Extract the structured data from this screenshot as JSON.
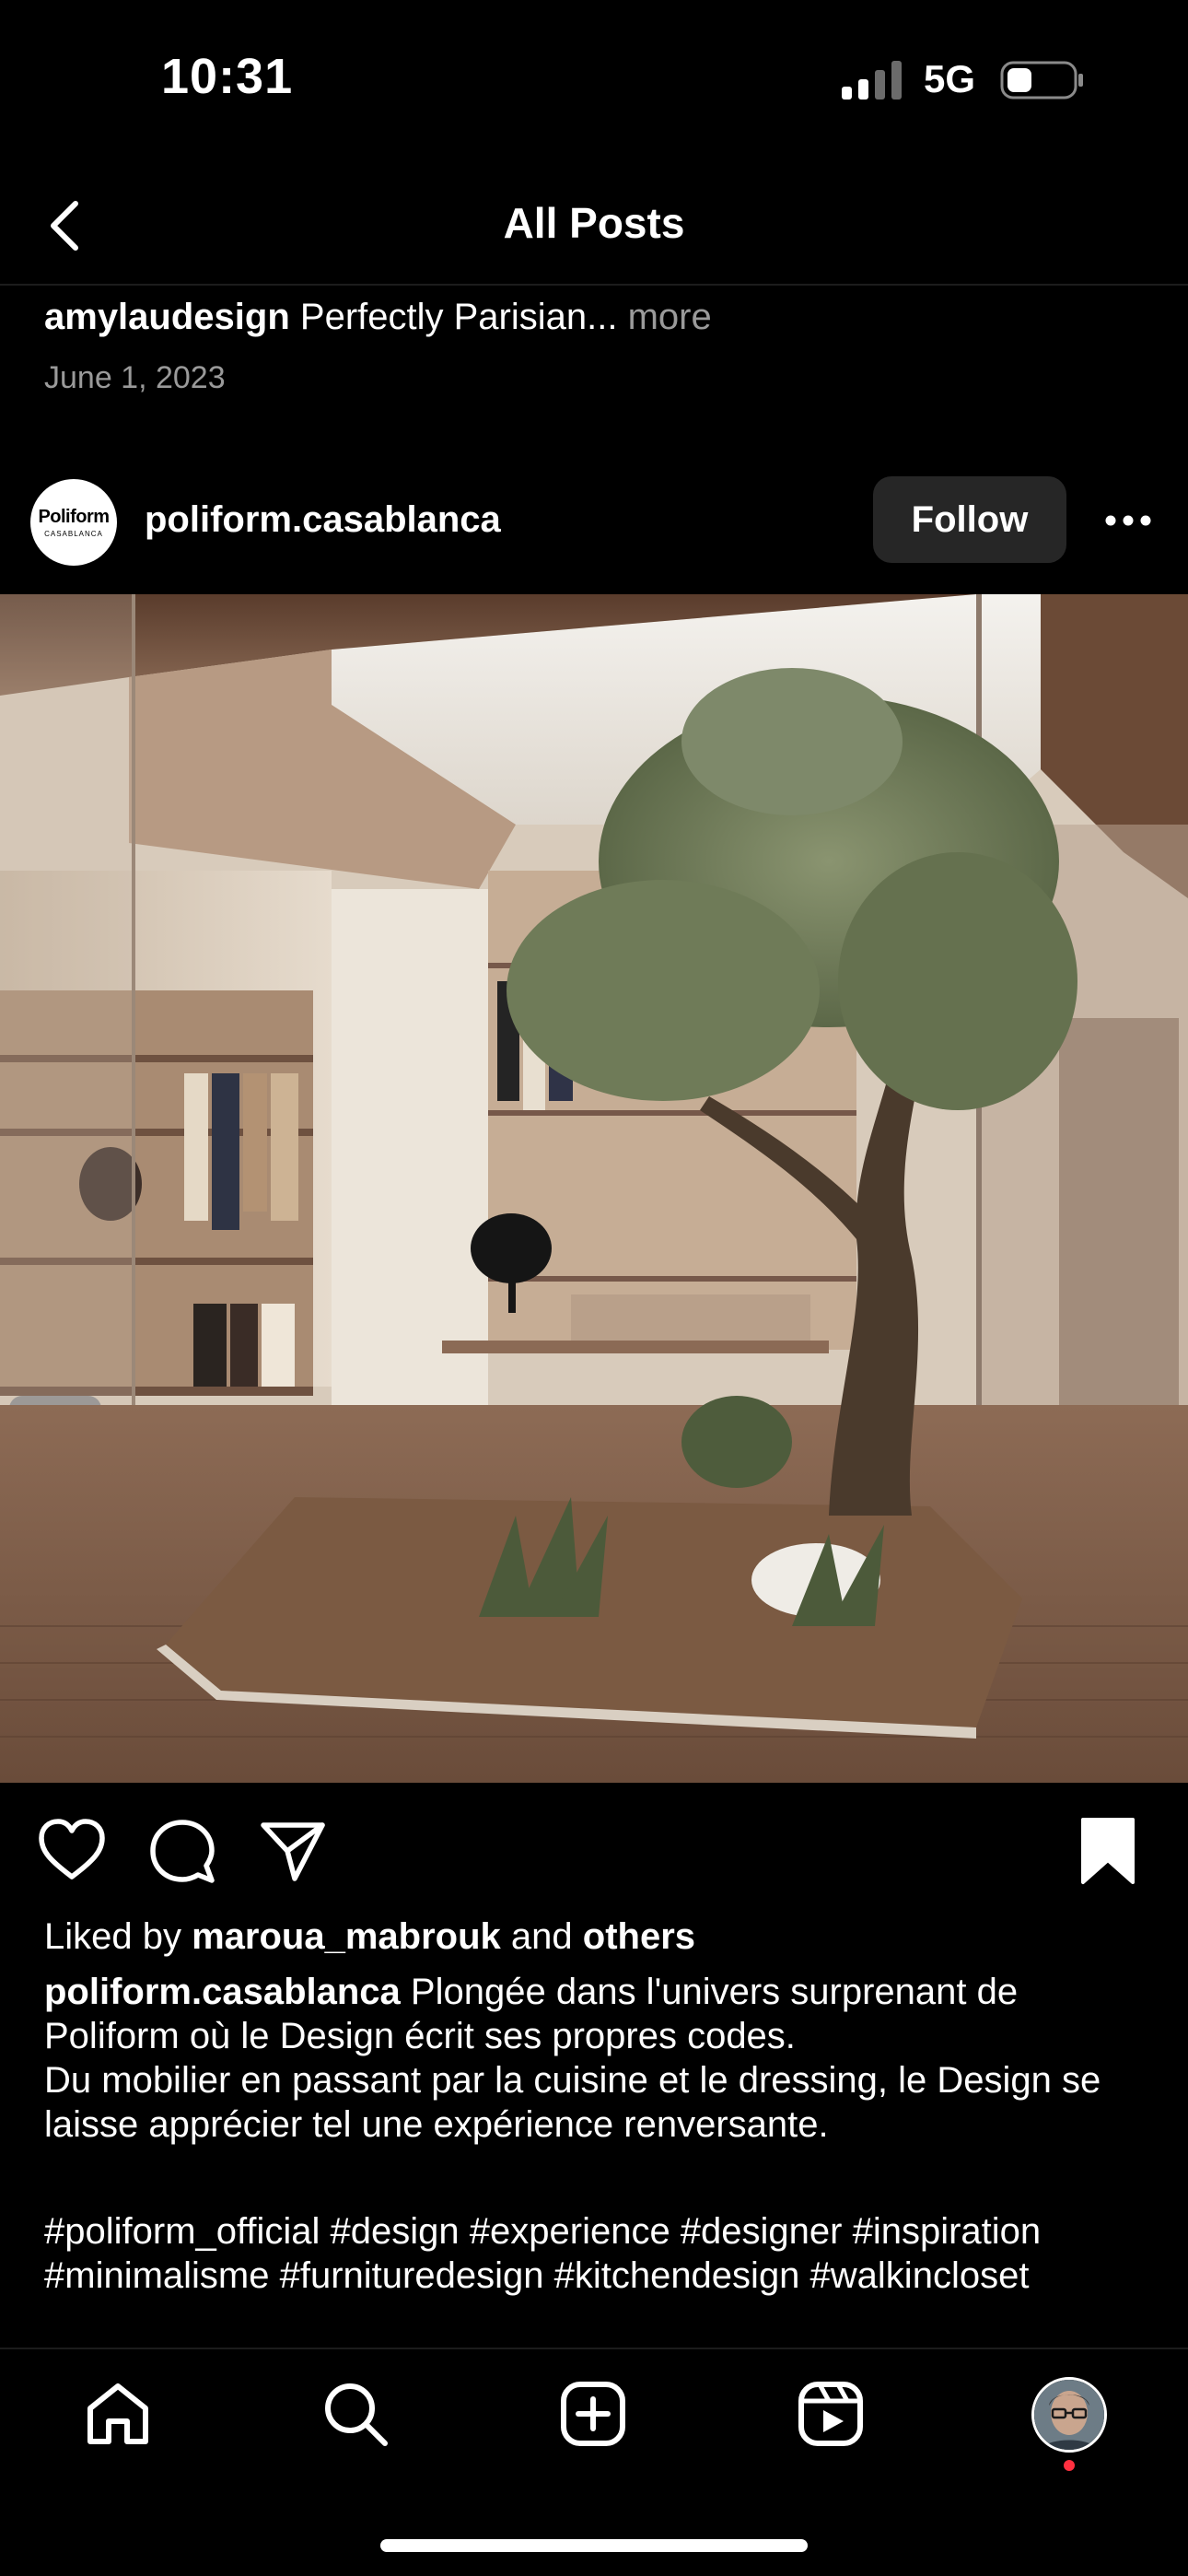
{
  "status_bar": {
    "time": "10:31",
    "network": "5G"
  },
  "header": {
    "title": "All Posts",
    "back_icon": "chevron-left-icon"
  },
  "previous_post": {
    "username": "amylaudesign",
    "caption": "Perfectly Parisian...",
    "more_label": "more",
    "date": "June 1, 2023"
  },
  "post": {
    "avatar_line1": "Poliform",
    "avatar_line2": "CASABLANCA",
    "username": "poliform.casablanca",
    "follow_label": "Follow",
    "actions": {
      "like_icon": "heart-icon",
      "comment_icon": "comment-icon",
      "share_icon": "paper-plane-icon",
      "save_icon": "bookmark-filled-icon"
    },
    "liked_by_prefix": "Liked by",
    "liked_by_user": "maroua_mabrouk",
    "liked_by_and": "and",
    "liked_by_others": "others",
    "caption_user": "poliform.casablanca",
    "caption_line1": "Plongée dans l'univers surprenant de Poliform où le Design écrit ses propres codes.",
    "caption_line2": "Du mobilier en passant par la cuisine et le dressing, le Design se laisse apprécier tel une expérience renversante.",
    "hashtags": "#poliform_official #design #experience #designer #inspiration #minimalisme #furnituredesign #kitchendesign #walkincloset"
  },
  "tab_bar": {
    "items": [
      "home-icon",
      "search-icon",
      "create-icon",
      "reels-icon",
      "profile-avatar"
    ]
  },
  "colors": {
    "background": "#000000",
    "secondary_text": "#9a9a9a",
    "button_bg": "#262626",
    "notification_dot": "#ff3040"
  }
}
